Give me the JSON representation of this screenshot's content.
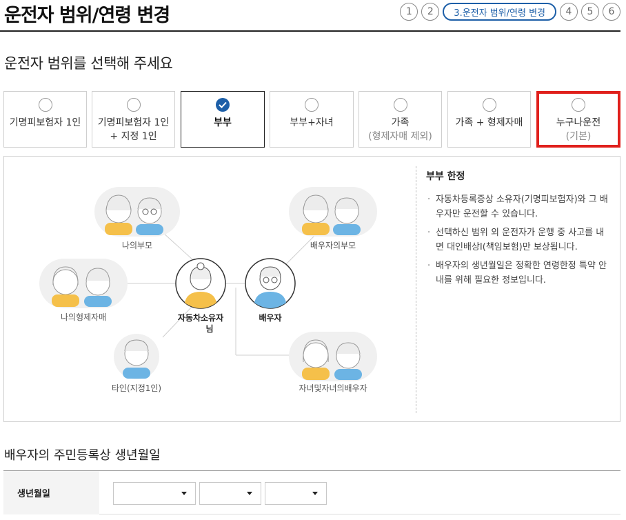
{
  "header": {
    "title": "운전자 범위/연령 변경",
    "steps": [
      "1",
      "2",
      "3.운전자 범위/연령 변경",
      "4",
      "5",
      "6"
    ]
  },
  "section_title": "운전자 범위를 선택해 주세요",
  "options": [
    {
      "label": "기명피보험자 1인",
      "sub": ""
    },
    {
      "label": "기명피보험자 1인",
      "sub": "+ 지정 1인"
    },
    {
      "label": "부부",
      "sub": ""
    },
    {
      "label": "부부+자녀",
      "sub": ""
    },
    {
      "label": "가족",
      "sub": "(형제자매 제외)"
    },
    {
      "label": "가족 + 형제자매",
      "sub": ""
    },
    {
      "label": "누구나운전",
      "sub": "(기본)"
    }
  ],
  "selected_option": "부부",
  "diagram": {
    "center_owner_line1": "자동차소유자",
    "center_owner_line2": "님",
    "spouse": "배우자",
    "my_parents": "나의부모",
    "spouse_parents": "배우자의부모",
    "my_siblings": "나의형제자매",
    "other": "타인(지정1인)",
    "children": "자녀및자녀의배우자"
  },
  "info": {
    "title": "부부 한정",
    "items": [
      "자동차등록증상 소유자(기명피보험자)와 그 배우자만 운전할 수 있습니다.",
      "선택하신 범위 외 운전자가 운행 중 사고를 내면 대인배상I(책임보험)만 보상됩니다.",
      "배우자의 생년월일은 정확한 연령한정 특약 안내를 위해 필요한 정보입니다."
    ]
  },
  "section2_title": "배우자의 주민등록상 생년월일",
  "form": {
    "birth_label": "생년월일",
    "year_value": "",
    "month_value": "",
    "day_value": ""
  },
  "colors": {
    "accent": "#1d5fa8",
    "highlight": "#e0201c",
    "owner_shirt": "#f5c04a",
    "spouse_shirt": "#6cb4e4",
    "bubble": "#f0f0f0"
  }
}
